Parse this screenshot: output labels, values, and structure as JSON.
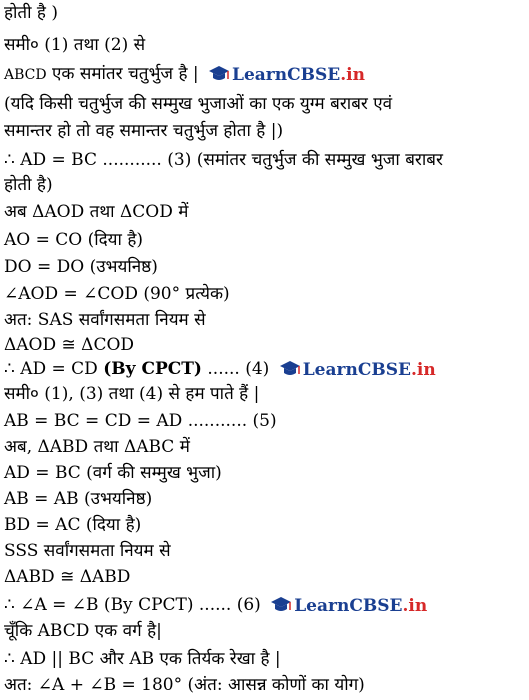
{
  "lines": [
    "होती है )",
    "समी० (1) तथा (2) से",
    "एक समांतर चतुर्भुज है |",
    "(यदि किसी चतुर्भुज की सम्मुख भुजाओं का एक युग्म बराबर एवं",
    "समान्तर हो तो वह समान्तर चतुर्भुज होता है |)",
    "∴ AD = BC ........... (3)  (समांतर चतुर्भुज की सम्मुख भुजा बराबर",
    "होती है)",
    "अब ΔAOD तथा ΔCOD में",
    "AO = CO  (दिया है)",
    "DO = DO  (उभयनिष्ठ)",
    "∠AOD = ∠COD (90° प्रत्येक)",
    "अत: SAS सर्वांगसमता नियम से",
    "ΔAOD ≅ ΔCOD",
    "∴ AD = CD",
    "(By CPCT)",
    "...... (4)",
    "समी० (1), (3) तथा (4) से हम पाते हैं |",
    "AB = BC = CD = AD ........... (5)",
    "अब, ΔABD तथा ΔABC में",
    "AD = BC  (वर्ग की सम्मुख भुजा)",
    "AB = AB  (उभयनिष्ठ)",
    "BD = AC  (दिया है)",
    "SSS सर्वांगसमता नियम से",
    "ΔABD ≅ ΔABD",
    "∴ ∠A = ∠B (By CPCT) ...... (6)",
    "चूँकि ABCD एक वर्ग है|",
    "∴ AD || BC और AB एक तिर्यक रेखा है |",
    "अत: ∠A + ∠B = 180°  (अंत: आसन्न कोणों का योग)"
  ],
  "abcd_label": "ABCD",
  "logo": {
    "main": "LearnCBSE",
    "suffix": ".in",
    "color": "#1a3f91",
    "suffix_color": "#d62828"
  }
}
